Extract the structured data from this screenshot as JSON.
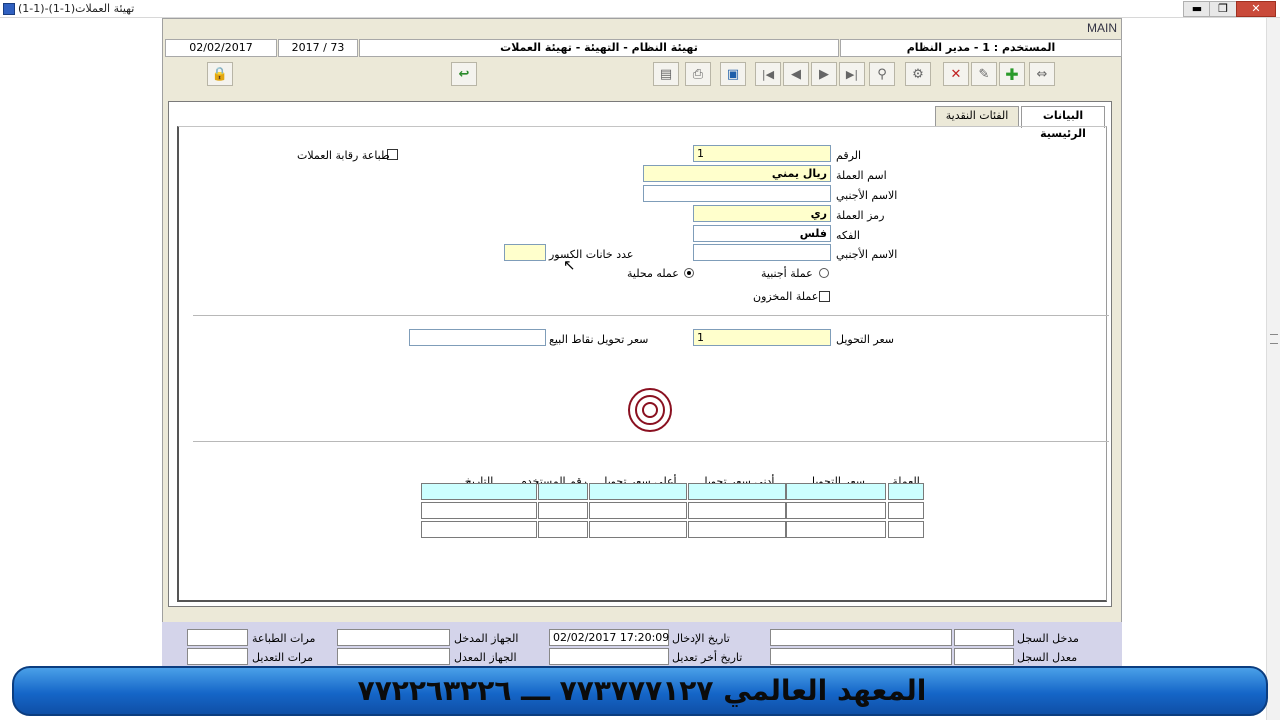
{
  "window": {
    "title": "تهيئة العملات(1-1)-(1-1)",
    "minimize": "▬",
    "restore": "❐",
    "close": "✕"
  },
  "app": {
    "main_label": "MAIN"
  },
  "infobar": {
    "user": "المستخدم : 1 - مدير النظام",
    "breadcrumb": "تهيئة النظام - التهيئة - تهيئة العملات",
    "period": "2017 / 73",
    "date": "02/02/2017"
  },
  "toolbar": {
    "icons": [
      "move-icon",
      "add-icon",
      "edit-icon",
      "delete-icon",
      "tools-icon",
      "search-icon",
      "last-record-icon",
      "next-record-icon",
      "previous-record-icon",
      "first-record-icon",
      "save-icon",
      "print-icon",
      "layout-icon",
      "undo-icon",
      "lock-icon"
    ]
  },
  "tabs": [
    {
      "label": "البيانات الرئيسية",
      "active": true
    },
    {
      "label": "الفئات النقدية",
      "active": false
    }
  ],
  "form": {
    "number_label": "الرقم",
    "number_value": "1",
    "currency_name_label": "اسم العملة",
    "currency_name_value": "ريال يمني",
    "foreign_name_label": "الاسم الأجنبي",
    "foreign_name_value": "",
    "currency_code_label": "رمز العملة",
    "currency_code_value": "ري",
    "fraction_label": "الفكه",
    "fraction_value": "فلس",
    "fraction_foreign_label": "الاسم الأجنبي",
    "fraction_foreign_value": "",
    "decimals_label": "عدد خانات الكسور",
    "decimals_value": "",
    "foreign_currency_label": "عملة أجنبية",
    "local_currency_label": "عمله محلية",
    "stock_currency_label": "عملة المخزون",
    "print_control_label": "طباعة رقابة العملات",
    "exchange_rate_label": "سعر التحويل",
    "exchange_rate_value": "1",
    "pos_rate_label": "سعر تحويل نقاط البيع",
    "pos_rate_value": ""
  },
  "grid": {
    "columns": [
      "العملة",
      "سعر التحويل",
      "أدنى سعر تحويل",
      "أعلى سعر تحويل",
      "رقم المستخدم",
      "التاريخ"
    ]
  },
  "footer": {
    "entered_by_label": "مدخل السجل",
    "modified_by_label": "معدل السجل",
    "entry_date_label": "تاريخ الإدخال",
    "entry_date_value": "02/02/2017 17:20:09",
    "last_mod_label": "تاريخ أخر تعديل",
    "entry_device_label": "الجهاز المدخل",
    "mod_device_label": "الجهاز المعدل",
    "print_count_label": "مرات الطباعة",
    "edit_count_label": "مرات التعديل"
  },
  "banner": {
    "text": "المعهد العالمي   ٧٧٣٧٧٧١٢٧   ـــ   ٧٧٢٢٦٣٢٢٦"
  },
  "colors": {
    "window_bg": "#ece9d8",
    "required_field": "#ffffcc",
    "grid_first_row": "#ccffff",
    "footer_bg": "#d4d4ea",
    "banner_blue": "#1566c8",
    "target_red": "#8a1020"
  }
}
